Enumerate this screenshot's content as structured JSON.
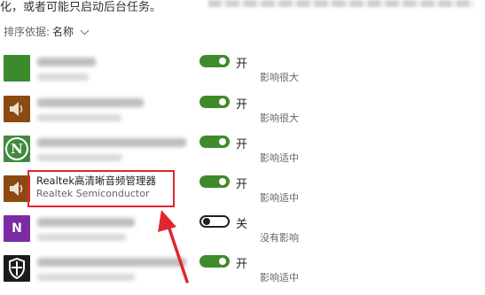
{
  "intro_text": "化，或者可能只启动后台任务。",
  "sort": {
    "label": "排序依据:",
    "value": "名称"
  },
  "apps": [
    {
      "icon": "green-app-icon",
      "toggle_label": "开",
      "toggle_on": true,
      "impact": "影响很大"
    },
    {
      "icon": "speaker-icon",
      "toggle_label": "开",
      "toggle_on": true,
      "impact": "影响很大"
    },
    {
      "icon": "n-logo-icon",
      "toggle_label": "开",
      "toggle_on": true,
      "impact": "影响适中"
    },
    {
      "icon": "speaker-icon",
      "name": "Realtek高清晰音频管理器",
      "publisher": "Realtek Semiconductor",
      "toggle_label": "开",
      "toggle_on": true,
      "impact": "影响适中"
    },
    {
      "icon": "onenote-icon",
      "icon_text": "N",
      "toggle_label": "关",
      "toggle_on": false,
      "impact": "没有影响"
    },
    {
      "icon": "shield-icon",
      "toggle_label": "开",
      "toggle_on": true,
      "impact": "影响适中"
    }
  ],
  "colors": {
    "toggle_on": "#3f8a2b",
    "highlight": "#e0262e"
  }
}
